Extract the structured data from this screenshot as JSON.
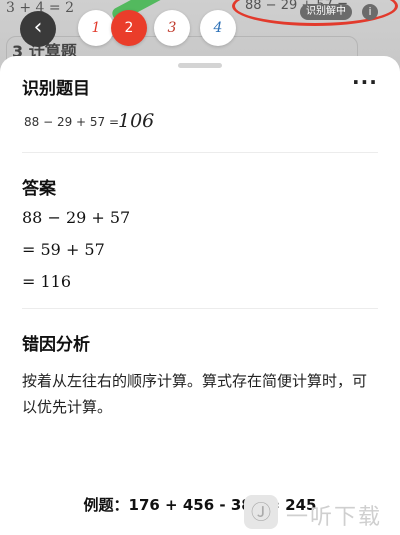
{
  "background": {
    "scribble": "3 + 4 = 2",
    "calc_label": "3 计算题",
    "equation_fragment": "88 − 29 + 57 =",
    "recognizing_label": "识别解中"
  },
  "nav": {
    "back_icon": "chevron-left-icon",
    "steps": [
      "1",
      "2",
      "3",
      "4"
    ],
    "active_step": "2",
    "step_colors": [
      "#e23a2c",
      "#ffffff",
      "#c0392b",
      "#2b6fb6"
    ]
  },
  "recognition": {
    "title": "识别题目",
    "more_icon": "more-dots-icon",
    "printed": "88 − 29 + 57 =",
    "handwritten": "106"
  },
  "answer": {
    "title": "答案",
    "lines": [
      "88 − 29 + 57",
      "= 59 + 57",
      "= 116"
    ]
  },
  "analysis": {
    "title": "错因分析",
    "text": "按着从左往右的顺序计算。算式存在简便计算时，可以优先计算。"
  },
  "example": {
    "text": "例题：176 + 456 - 387 = 245"
  },
  "watermark": {
    "text": "一听下载"
  },
  "colors": {
    "accent": "#ea3d2a",
    "sheet_bg": "#ffffff"
  }
}
